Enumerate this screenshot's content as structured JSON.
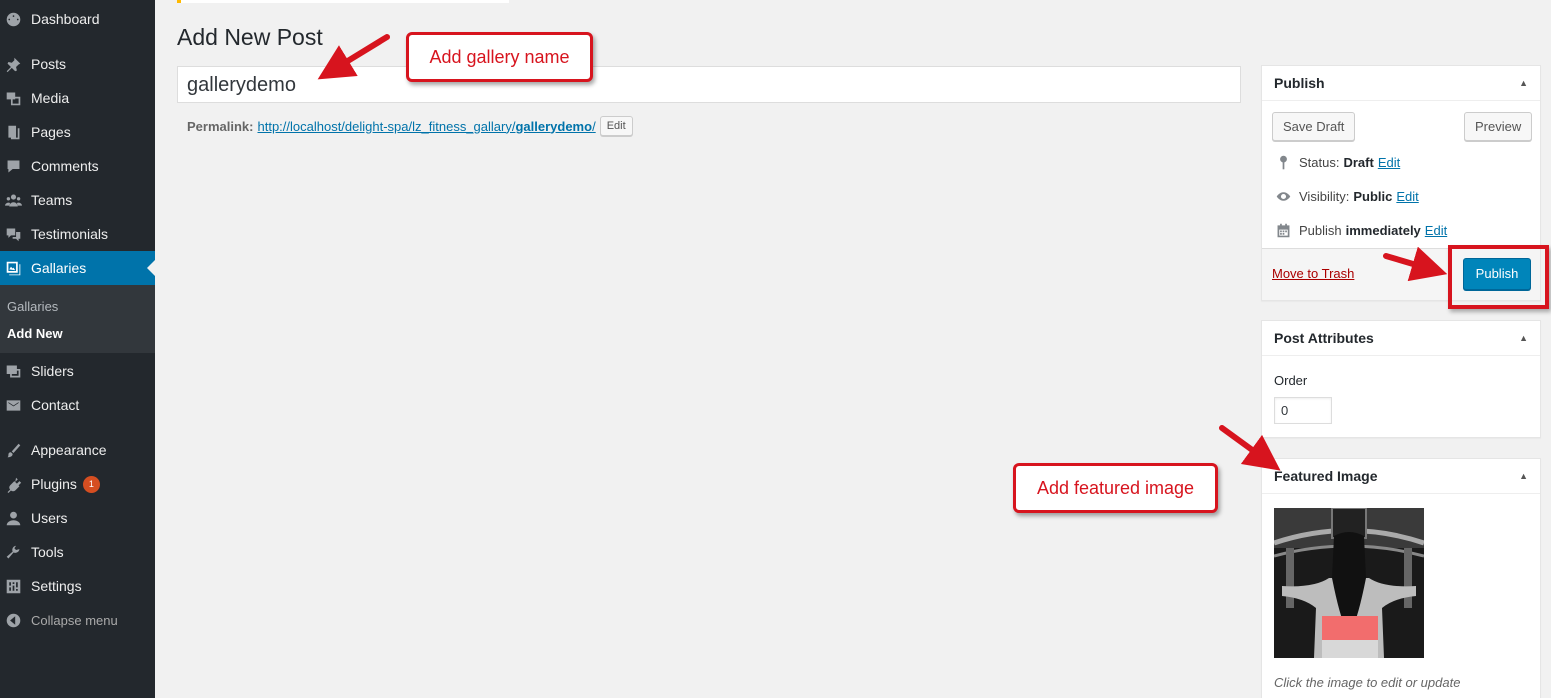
{
  "sidebar": {
    "items": [
      {
        "label": "Dashboard",
        "icon": "dashboard-icon"
      },
      {
        "label": "Posts",
        "icon": "pin-icon"
      },
      {
        "label": "Media",
        "icon": "media-icon"
      },
      {
        "label": "Pages",
        "icon": "pages-icon"
      },
      {
        "label": "Comments",
        "icon": "comment-icon"
      },
      {
        "label": "Teams",
        "icon": "groups-icon"
      },
      {
        "label": "Testimonials",
        "icon": "testimonial-icon"
      },
      {
        "label": "Gallaries",
        "icon": "gallery-icon",
        "active": true
      },
      {
        "label": "Sliders",
        "icon": "slides-icon"
      },
      {
        "label": "Contact",
        "icon": "email-icon"
      },
      {
        "label": "Appearance",
        "icon": "brush-icon"
      },
      {
        "label": "Plugins",
        "icon": "plugin-icon",
        "badge": "1"
      },
      {
        "label": "Users",
        "icon": "user-icon"
      },
      {
        "label": "Tools",
        "icon": "wrench-icon"
      },
      {
        "label": "Settings",
        "icon": "settings-icon"
      }
    ],
    "submenu": [
      "Gallaries",
      "Add New"
    ],
    "collapse_label": "Collapse menu"
  },
  "editor": {
    "page_title": "Add New Post",
    "title_value": "gallerydemo",
    "permalink_label": "Permalink:",
    "permalink_base": "http://localhost/delight-spa/lz_fitness_gallary/",
    "permalink_slug": "gallerydemo",
    "permalink_end": "/",
    "edit_label": "Edit"
  },
  "publish": {
    "title": "Publish",
    "save_draft": "Save Draft",
    "preview": "Preview",
    "status_label": "Status:",
    "status_value": "Draft",
    "visibility_label": "Visibility:",
    "visibility_value": "Public",
    "publish_label": "Publish",
    "publish_value": "immediately",
    "edit": "Edit",
    "trash": "Move to Trash",
    "publish_button": "Publish"
  },
  "attributes": {
    "title": "Post Attributes",
    "order_label": "Order",
    "order_value": "0"
  },
  "featured": {
    "title": "Featured Image",
    "hint": "Click the image to edit or update"
  },
  "annotations": {
    "gallery_name": "Add gallery name",
    "featured_image": "Add featured image"
  },
  "colors": {
    "sidebar": "#23282d",
    "accent": "#0073aa",
    "annotation": "#d7141e"
  }
}
